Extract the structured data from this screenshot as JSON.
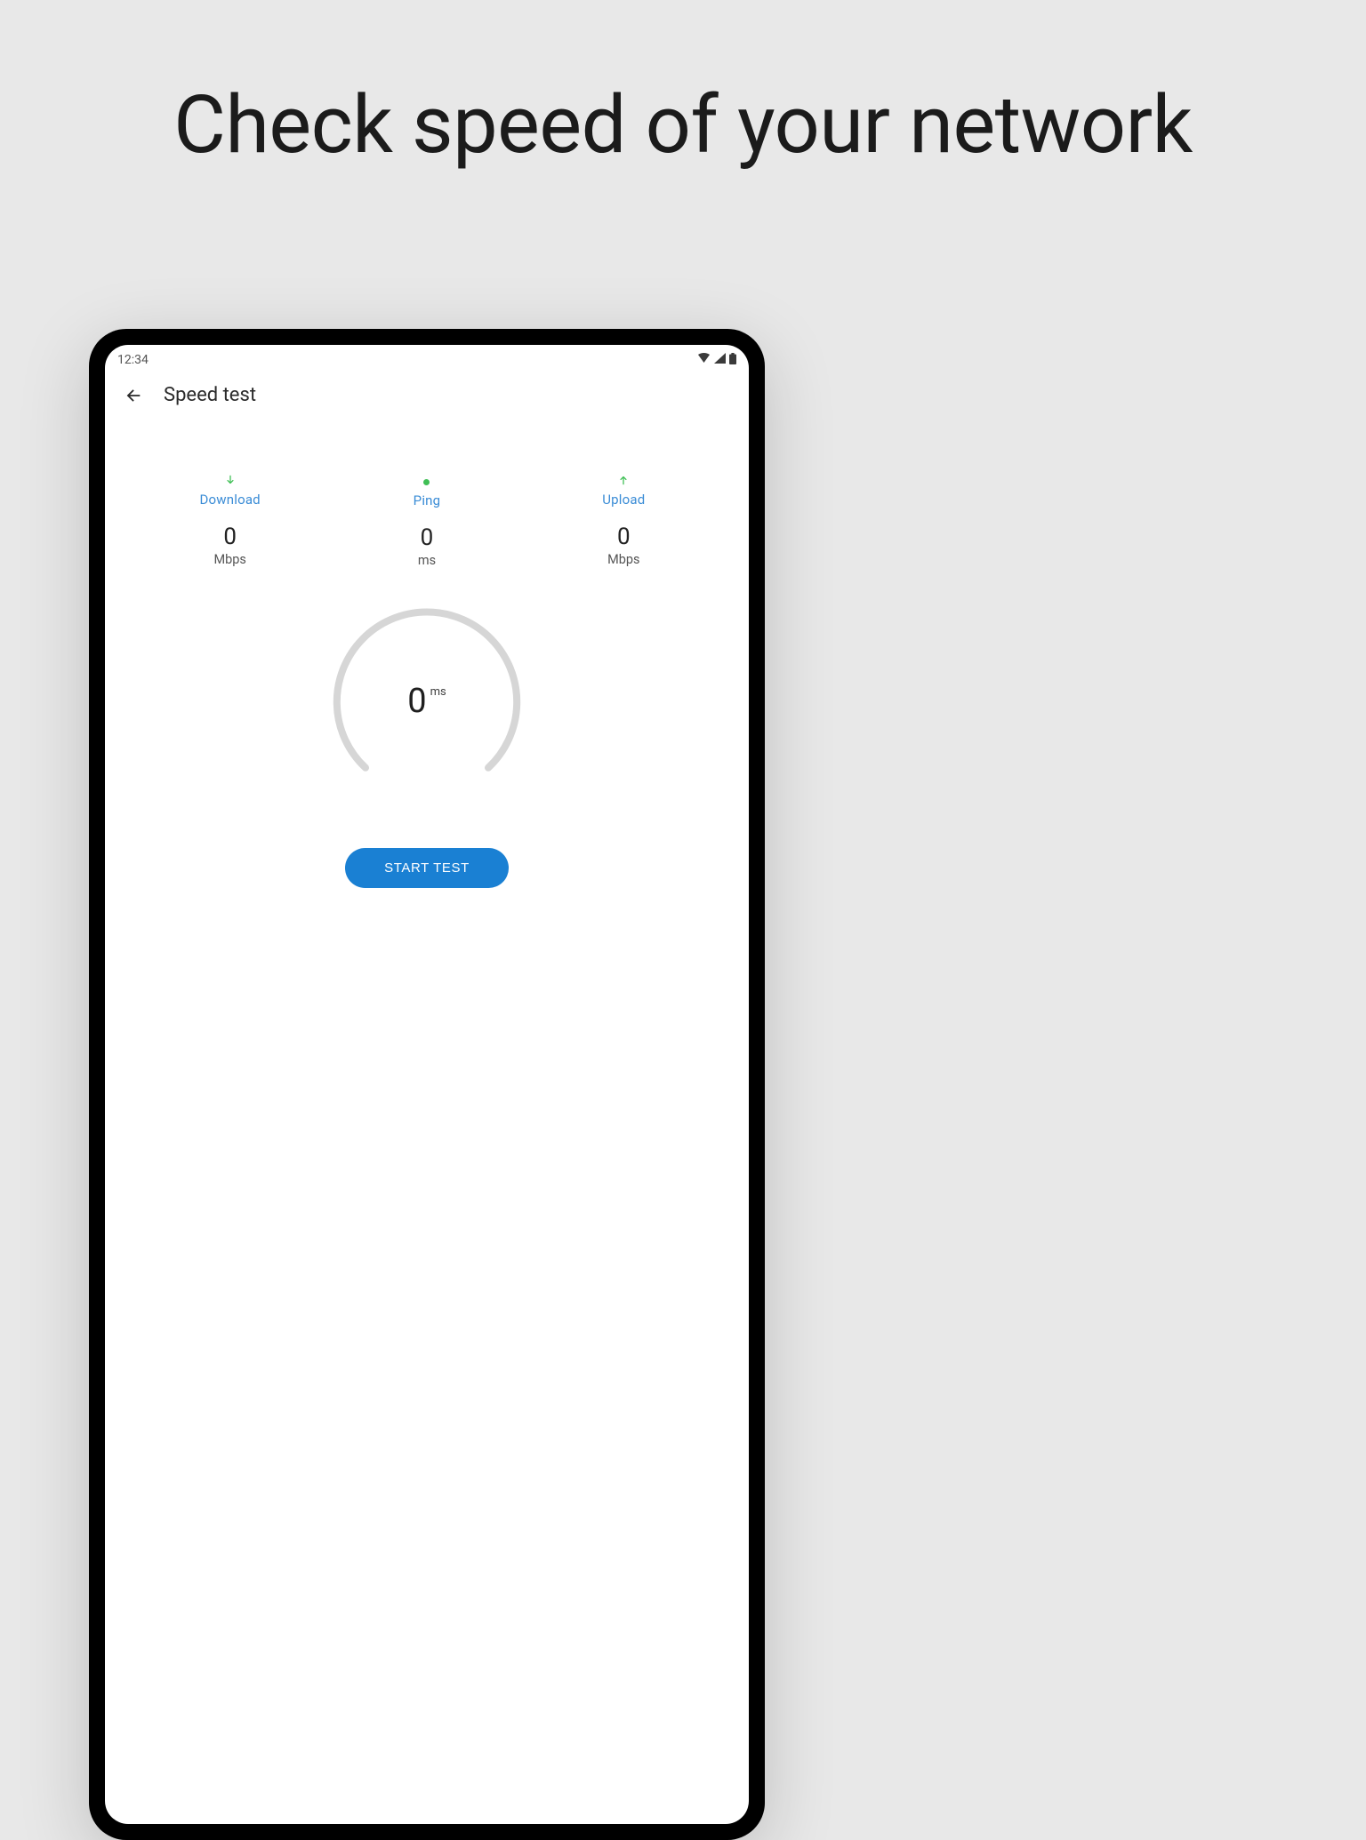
{
  "marketing_heading": "Check speed of your network",
  "status_bar": {
    "time": "12:34"
  },
  "app_bar": {
    "title": "Speed test"
  },
  "metrics": {
    "download": {
      "label": "Download",
      "value": "0",
      "unit": "Mbps"
    },
    "ping": {
      "label": "Ping",
      "value": "0",
      "unit": "ms"
    },
    "upload": {
      "label": "Upload",
      "value": "0",
      "unit": "Mbps"
    }
  },
  "gauge": {
    "value": "0",
    "unit": "ms"
  },
  "buttons": {
    "start": "START TEST"
  },
  "colors": {
    "accent_blue": "#1a80d3",
    "label_blue": "#3a8cd6",
    "icon_green": "#3fbf55"
  }
}
